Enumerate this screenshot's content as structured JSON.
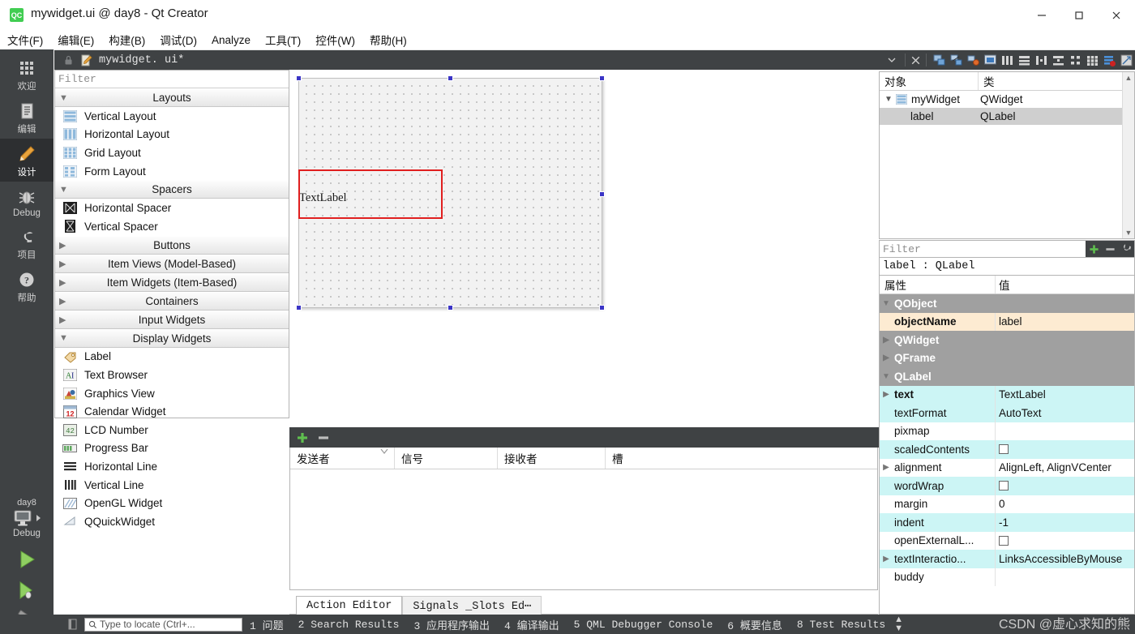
{
  "window": {
    "title": "mywidget.ui @ day8 - Qt Creator",
    "app_icon_text": "QC",
    "minimize_label": "–",
    "maximize_label": "□",
    "close_label": "✕"
  },
  "menubar": {
    "items": [
      {
        "label": "文件(F)",
        "name": "menu-file"
      },
      {
        "label": "编辑(E)",
        "name": "menu-edit"
      },
      {
        "label": "构建(B)",
        "name": "menu-build"
      },
      {
        "label": "调试(D)",
        "name": "menu-debug"
      },
      {
        "label": "Analyze",
        "name": "menu-analyze"
      },
      {
        "label": "工具(T)",
        "name": "menu-tools"
      },
      {
        "label": "控件(W)",
        "name": "menu-window"
      },
      {
        "label": "帮助(H)",
        "name": "menu-help"
      }
    ]
  },
  "modebar": {
    "modes": [
      {
        "label": "欢迎",
        "icon": "grid-icon",
        "active": false
      },
      {
        "label": "编辑",
        "icon": "document-icon",
        "active": false
      },
      {
        "label": "设计",
        "icon": "pencil-icon",
        "active": true
      },
      {
        "label": "Debug",
        "icon": "bug-icon",
        "active": false
      },
      {
        "label": "项目",
        "icon": "wrench-icon",
        "active": false
      },
      {
        "label": "帮助",
        "icon": "question-icon",
        "active": false
      }
    ],
    "kit_name": "day8",
    "kit_mode": "Debug",
    "run_icon": "run-play-icon",
    "debug_icon": "debug-play-icon",
    "build_icon": "hammer-icon"
  },
  "editor_tab": {
    "lock_icon": "lock-icon",
    "file_icon": "file-edit-icon",
    "filename": "mywidget. ui*",
    "dropdown_icon": "chevron-down-icon",
    "close_icon": "close-icon",
    "tools": [
      "edit-widgets-icon",
      "edit-signals-icon",
      "edit-buddies-icon",
      "edit-tab-order-icon",
      "layout-horizontal-icon",
      "layout-vertical-icon",
      "layout-splitter-h-icon",
      "layout-splitter-v-icon",
      "layout-form-icon",
      "layout-grid-icon",
      "break-layout-icon",
      "adjust-size-icon"
    ]
  },
  "widgetbox": {
    "filter_placeholder": "Filter",
    "sections": [
      {
        "name": "Layouts",
        "expanded": true,
        "items": [
          {
            "label": "Vertical Layout",
            "icon": "vertical-layout-icon"
          },
          {
            "label": "Horizontal Layout",
            "icon": "horizontal-layout-icon"
          },
          {
            "label": "Grid Layout",
            "icon": "grid-layout-icon"
          },
          {
            "label": "Form Layout",
            "icon": "form-layout-icon"
          }
        ]
      },
      {
        "name": "Spacers",
        "expanded": true,
        "items": [
          {
            "label": "Horizontal Spacer",
            "icon": "horizontal-spacer-icon"
          },
          {
            "label": "Vertical Spacer",
            "icon": "vertical-spacer-icon"
          }
        ]
      },
      {
        "name": "Buttons",
        "expanded": false,
        "items": []
      },
      {
        "name": "Item Views (Model-Based)",
        "expanded": false,
        "items": []
      },
      {
        "name": "Item Widgets (Item-Based)",
        "expanded": false,
        "items": []
      },
      {
        "name": "Containers",
        "expanded": false,
        "items": []
      },
      {
        "name": "Input Widgets",
        "expanded": false,
        "items": []
      },
      {
        "name": "Display Widgets",
        "expanded": true,
        "items": [
          {
            "label": "Label",
            "icon": "label-tag-icon"
          },
          {
            "label": "Text Browser",
            "icon": "text-browser-icon"
          },
          {
            "label": "Graphics View",
            "icon": "graphics-view-icon"
          },
          {
            "label": "Calendar Widget",
            "icon": "calendar-icon"
          },
          {
            "label": "LCD Number",
            "icon": "lcd-number-icon"
          },
          {
            "label": "Progress Bar",
            "icon": "progress-bar-icon"
          },
          {
            "label": "Horizontal Line",
            "icon": "horizontal-line-icon"
          },
          {
            "label": "Vertical Line",
            "icon": "vertical-line-icon"
          },
          {
            "label": "OpenGL Widget",
            "icon": "opengl-widget-icon"
          },
          {
            "label": "QQuickWidget",
            "icon": "qquickwidget-icon"
          }
        ]
      }
    ]
  },
  "canvas": {
    "label_text": "TextLabel",
    "highlight_color": "#e01f1f",
    "handle_color": "#3b35c6"
  },
  "object_tree": {
    "columns": [
      "对象",
      "类"
    ],
    "rows": [
      {
        "name": "myWidget",
        "class": "QWidget",
        "depth": 0,
        "expanded": true,
        "selected": false,
        "icon": "widget-icon"
      },
      {
        "name": "label",
        "class": "QLabel",
        "depth": 1,
        "expanded": false,
        "selected": true,
        "icon": ""
      }
    ]
  },
  "property_editor": {
    "filter_placeholder": "Filter",
    "add_button": "+",
    "remove_button": "–",
    "config_button": "wrench-icon",
    "object_header": "label : QLabel",
    "columns": [
      "属性",
      "值"
    ],
    "rows": [
      {
        "name": "QObject",
        "value": "",
        "type": "group",
        "expanded": true
      },
      {
        "name": "objectName",
        "value": "label",
        "type": "highlight",
        "bold": true
      },
      {
        "name": "QWidget",
        "value": "",
        "type": "group",
        "expanded": false
      },
      {
        "name": "QFrame",
        "value": "",
        "type": "group",
        "expanded": false
      },
      {
        "name": "QLabel",
        "value": "",
        "type": "group",
        "expanded": true
      },
      {
        "name": "text",
        "value": "TextLabel",
        "type": "cyan",
        "bold": true,
        "expandable": true
      },
      {
        "name": "textFormat",
        "value": "AutoText",
        "type": "cyan"
      },
      {
        "name": "pixmap",
        "value": "",
        "type": "white"
      },
      {
        "name": "scaledContents",
        "value": "",
        "type": "cyan",
        "checkbox": true,
        "checked": false
      },
      {
        "name": "alignment",
        "value": "AlignLeft, AlignVCenter",
        "type": "white",
        "expandable": true
      },
      {
        "name": "wordWrap",
        "value": "",
        "type": "cyan",
        "checkbox": true,
        "checked": false
      },
      {
        "name": "margin",
        "value": "0",
        "type": "white"
      },
      {
        "name": "indent",
        "value": "-1",
        "type": "cyan"
      },
      {
        "name": "openExternalL...",
        "value": "",
        "type": "white",
        "checkbox": true,
        "checked": false
      },
      {
        "name": "textInteractio...",
        "value": "LinksAccessibleByMouse",
        "type": "cyan",
        "expandable": true
      },
      {
        "name": "buddy",
        "value": "",
        "type": "white"
      }
    ]
  },
  "signal_slot_editor": {
    "add_button": "+",
    "remove_button": "–",
    "columns": [
      "发送者",
      "信号",
      "接收者",
      "槽"
    ],
    "rows": []
  },
  "bottom_tabs": [
    {
      "label": "Action Editor",
      "selected": true
    },
    {
      "label": "Signals _Slots Ed⋯",
      "selected": false
    }
  ],
  "statusbar": {
    "locator_placeholder": "Type to locate (Ctrl+...",
    "search_icon": "search-icon",
    "items": [
      "1 问题",
      "2 Search Results",
      "3 应用程序输出",
      "4 编译输出",
      "5 QML Debugger Console",
      "6 概要信息",
      "8 Test Results"
    ],
    "expand_icon": "updown-arrow-icon",
    "watermark": "CSDN @虚心求知的熊"
  }
}
